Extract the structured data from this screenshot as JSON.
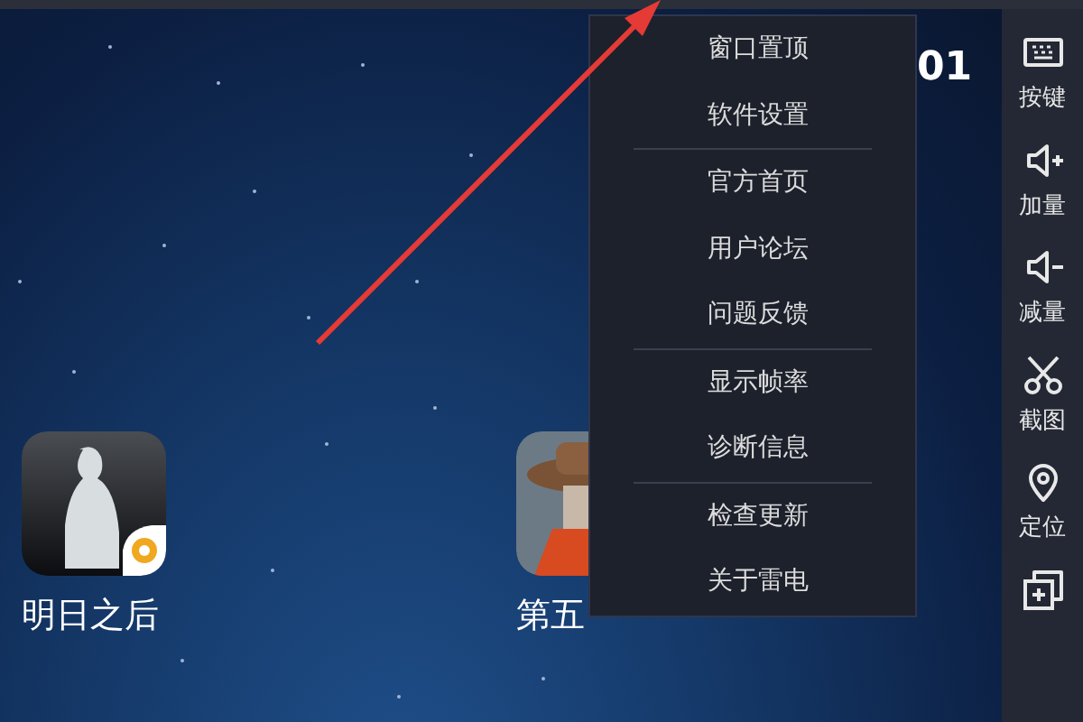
{
  "clock": "01",
  "apps": [
    {
      "label": "明日之后",
      "kind": "survivor"
    },
    {
      "label": "第五",
      "kind": "hat"
    }
  ],
  "menu": {
    "groups": [
      {
        "items": [
          "窗口置顶",
          "软件设置"
        ]
      },
      {
        "items": [
          "官方首页",
          "用户论坛",
          "问题反馈"
        ]
      },
      {
        "items": [
          "显示帧率",
          "诊断信息"
        ]
      },
      {
        "items": [
          "检查更新",
          "关于雷电"
        ]
      }
    ]
  },
  "sidebar": {
    "items": [
      {
        "kind": "keyboard",
        "label": "按键"
      },
      {
        "kind": "volume-up",
        "label": "加量"
      },
      {
        "kind": "volume-down",
        "label": "减量"
      },
      {
        "kind": "scissors",
        "label": "截图"
      },
      {
        "kind": "pin",
        "label": "定位"
      },
      {
        "kind": "add-window"
      }
    ]
  }
}
